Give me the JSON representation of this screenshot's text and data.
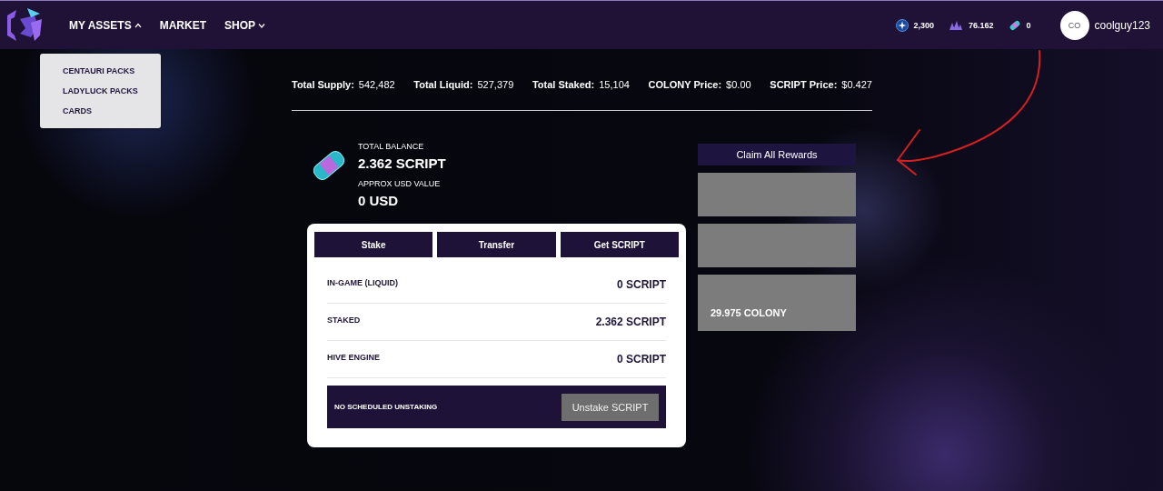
{
  "nav": {
    "items": [
      {
        "label": "MY ASSETS",
        "kind": "dropdown",
        "expanded": true,
        "menu": [
          "CENTAURI PACKS",
          "LADYLUCK PACKS",
          "CARDS"
        ]
      },
      {
        "label": "MARKET",
        "kind": "link"
      },
      {
        "label": "SHOP",
        "kind": "dropdown",
        "expanded": false
      }
    ],
    "balances": [
      {
        "kind": "star",
        "value": "2,300"
      },
      {
        "kind": "crystal",
        "value": "76.162"
      },
      {
        "kind": "capsule",
        "value": "0"
      }
    ],
    "user": {
      "initials": "CO",
      "name": "coolguy123"
    }
  },
  "stats": [
    {
      "label": "Total Supply:",
      "value": "542,482"
    },
    {
      "label": "Total Liquid:",
      "value": "527,379"
    },
    {
      "label": "Total Staked:",
      "value": "15,104"
    },
    {
      "label": "COLONY Price:",
      "value": "$0.00"
    },
    {
      "label": "SCRIPT Price:",
      "value": "$0.427"
    }
  ],
  "balance": {
    "total_label": "TOTAL BALANCE",
    "total": "2.362 SCRIPT",
    "usd_label": "APPROX USD VALUE",
    "usd": "0 USD"
  },
  "actions": [
    "Stake",
    "Transfer",
    "Get SCRIPT"
  ],
  "holdings": [
    {
      "label": "IN-GAME (LIQUID)",
      "value": "0 SCRIPT"
    },
    {
      "label": "STAKED",
      "value": "2.362 SCRIPT"
    },
    {
      "label": "HIVE ENGINE",
      "value": "0 SCRIPT"
    }
  ],
  "unstaking": {
    "status": "NO SCHEDULED UNSTAKING",
    "button": "Unstake SCRIPT"
  },
  "rewards": {
    "claim_button": "Claim All Rewards",
    "panels": [
      {
        "kind": "blank"
      },
      {
        "kind": "blank"
      },
      {
        "kind": "amount",
        "text": "29.975 COLONY"
      }
    ]
  }
}
